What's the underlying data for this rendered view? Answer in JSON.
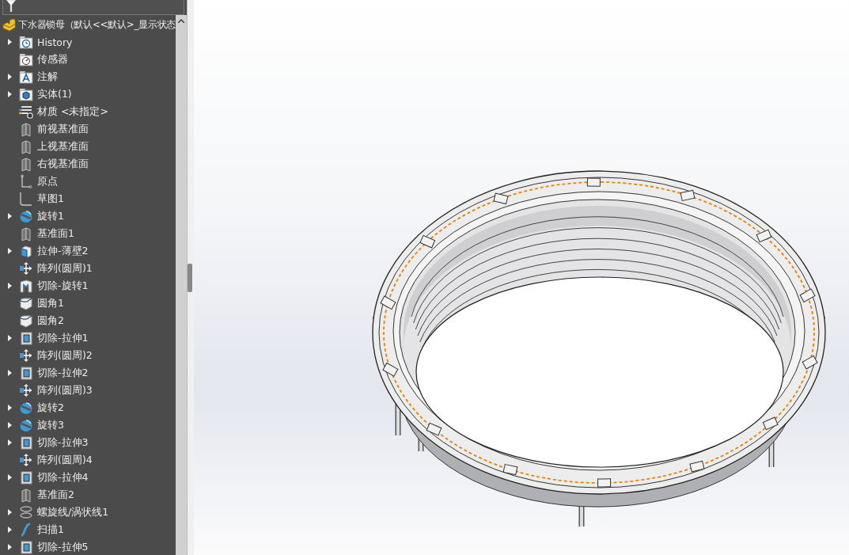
{
  "feature_tree": {
    "root": {
      "label": "下水器锁母（默认<<默认>_显示状态",
      "items": [
        {
          "label": "History",
          "kind": "history",
          "has_children": true
        },
        {
          "label": "传感器",
          "kind": "sensor",
          "has_children": false
        },
        {
          "label": "注解",
          "kind": "annotation",
          "has_children": true
        },
        {
          "label": "实体(1)",
          "kind": "solid",
          "has_children": true
        },
        {
          "label": "材质 <未指定>",
          "kind": "material",
          "has_children": false
        },
        {
          "label": "前视基准面",
          "kind": "plane",
          "has_children": false
        },
        {
          "label": "上视基准面",
          "kind": "plane",
          "has_children": false
        },
        {
          "label": "右视基准面",
          "kind": "plane",
          "has_children": false
        },
        {
          "label": "原点",
          "kind": "origin",
          "has_children": false
        },
        {
          "label": "草图1",
          "kind": "sketch",
          "has_children": false
        },
        {
          "label": "旋转1",
          "kind": "revolve",
          "has_children": true
        },
        {
          "label": "基准面1",
          "kind": "plane",
          "has_children": false
        },
        {
          "label": "拉伸-薄壁2",
          "kind": "extrude",
          "has_children": true
        },
        {
          "label": "阵列(圆周)1",
          "kind": "pattern",
          "has_children": false
        },
        {
          "label": "切除-旋转1",
          "kind": "cut-revolve",
          "has_children": true
        },
        {
          "label": "圆角1",
          "kind": "fillet",
          "has_children": false
        },
        {
          "label": "圆角2",
          "kind": "fillet",
          "has_children": false
        },
        {
          "label": "切除-拉伸1",
          "kind": "cut-extrude",
          "has_children": true
        },
        {
          "label": "阵列(圆周)2",
          "kind": "pattern",
          "has_children": false
        },
        {
          "label": "切除-拉伸2",
          "kind": "cut-extrude",
          "has_children": true
        },
        {
          "label": "阵列(圆周)3",
          "kind": "pattern",
          "has_children": false
        },
        {
          "label": "旋转2",
          "kind": "revolve",
          "has_children": true
        },
        {
          "label": "旋转3",
          "kind": "revolve",
          "has_children": true
        },
        {
          "label": "切除-拉伸3",
          "kind": "cut-extrude",
          "has_children": true
        },
        {
          "label": "阵列(圆周)4",
          "kind": "pattern",
          "has_children": false
        },
        {
          "label": "切除-拉伸4",
          "kind": "cut-extrude",
          "has_children": true
        },
        {
          "label": "基准面2",
          "kind": "plane",
          "has_children": false
        },
        {
          "label": "螺旋线/涡状线1",
          "kind": "helix",
          "has_children": true
        },
        {
          "label": "扫描1",
          "kind": "sweep",
          "has_children": true
        },
        {
          "label": "切除-拉伸5",
          "kind": "cut-extrude",
          "has_children": true
        }
      ]
    }
  }
}
